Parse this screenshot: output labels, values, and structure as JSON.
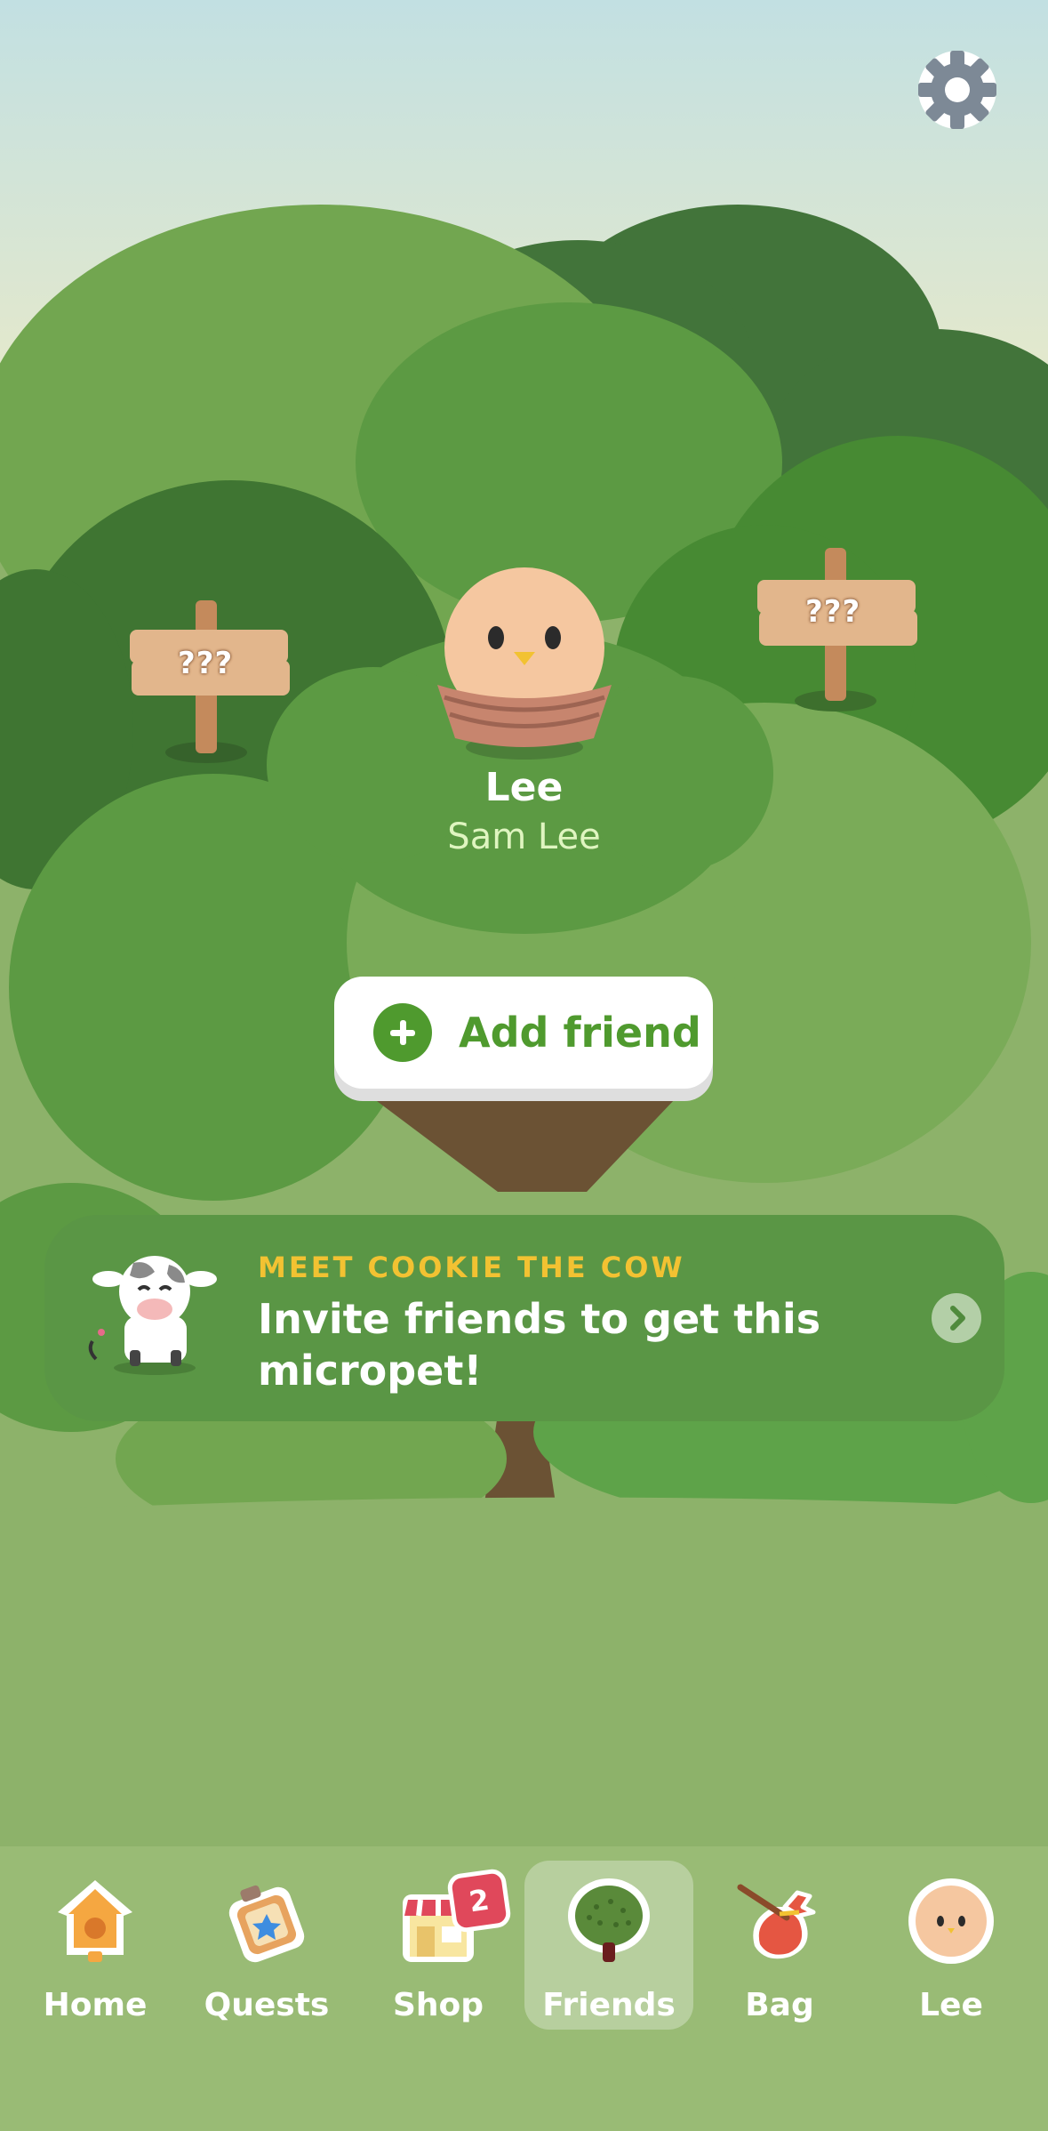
{
  "signs": {
    "left_label": "???",
    "right_label": "???"
  },
  "pet": {
    "name": "Lee",
    "owner": "Sam Lee"
  },
  "add_friend": {
    "label": "Add friend"
  },
  "promo": {
    "eyebrow": "MEET COOKIE THE COW",
    "title": "Invite friends to get this micropet!"
  },
  "tabs": [
    {
      "label": "Home",
      "icon": "birdhouse-icon"
    },
    {
      "label": "Quests",
      "icon": "quest-board-icon"
    },
    {
      "label": "Shop",
      "icon": "shop-icon",
      "badge": "2"
    },
    {
      "label": "Friends",
      "icon": "tree-icon",
      "active": true
    },
    {
      "label": "Bag",
      "icon": "bag-icon"
    },
    {
      "label": "Lee",
      "icon": "pet-avatar-icon"
    }
  ],
  "colors": {
    "accent_green": "#4f9a2e",
    "promo_yellow": "#f2c232",
    "badge_red": "#e0485b",
    "tabbar": "#99bb75"
  }
}
